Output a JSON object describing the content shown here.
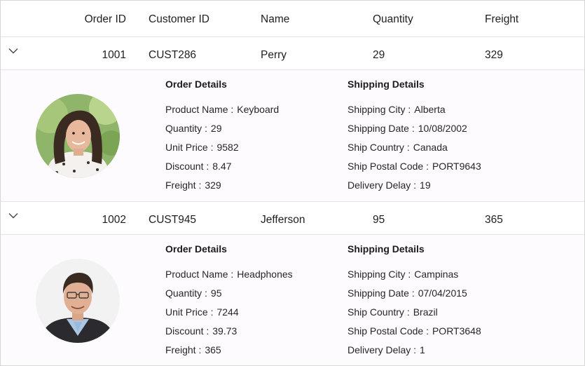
{
  "columns": [
    "Order ID",
    "Customer ID",
    "Name",
    "Quantity",
    "Freight"
  ],
  "icons": {
    "expander": "chevron-down-icon"
  },
  "colors": {
    "row_bg": "#ffffff",
    "detail_bg": "#fdfbfe",
    "border": "#e4e4e4"
  },
  "details_labels": {
    "order_title": "Order Details",
    "shipping_title": "Shipping Details",
    "product_name": "Product Name :",
    "quantity": "Quantity :",
    "unit_price": "Unit Price :",
    "discount": "Discount :",
    "freight": "Freight :",
    "shipping_city": "Shipping City :",
    "shipping_date": "Shipping Date :",
    "ship_country": "Ship Country :",
    "ship_postal_code": "Ship Postal Code :",
    "delivery_delay": "Delivery Delay :"
  },
  "rows": [
    {
      "order_id": "1001",
      "customer_id": "CUST286",
      "name": "Perry",
      "quantity": "29",
      "freight": "329",
      "details": {
        "product_name": "Keyboard",
        "quantity": "29",
        "unit_price": "9582",
        "discount": "8.47",
        "freight": "329",
        "shipping_city": "Alberta",
        "shipping_date": "10/08/2002",
        "ship_country": "Canada",
        "ship_postal_code": "PORT9643",
        "delivery_delay": "19"
      }
    },
    {
      "order_id": "1002",
      "customer_id": "CUST945",
      "name": "Jefferson",
      "quantity": "95",
      "freight": "365",
      "details": {
        "product_name": "Headphones",
        "quantity": "95",
        "unit_price": "7244",
        "discount": "39.73",
        "freight": "365",
        "shipping_city": "Campinas",
        "shipping_date": "07/04/2015",
        "ship_country": "Brazil",
        "ship_postal_code": "PORT3648",
        "delivery_delay": "1"
      }
    }
  ]
}
